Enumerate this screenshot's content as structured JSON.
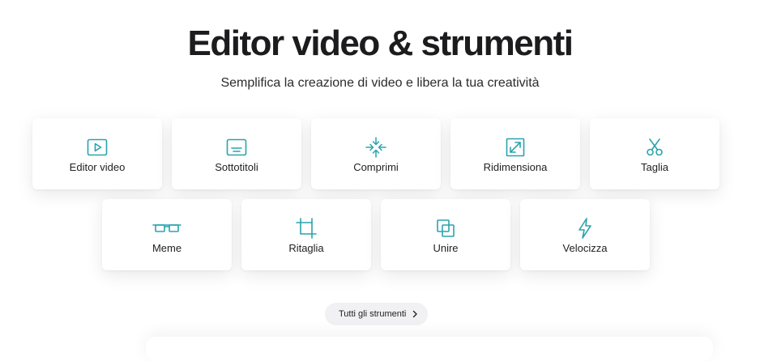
{
  "header": {
    "title": "Editor video & strumenti",
    "subtitle": "Semplifica la creazione di video e libera la tua creatività"
  },
  "colors": {
    "accent": "#2aa3ad",
    "card_background": "#ffffff",
    "button_background": "#f1f1f3"
  },
  "tools": {
    "row1": [
      {
        "label": "Editor video",
        "icon": "play-icon"
      },
      {
        "label": "Sottotitoli",
        "icon": "subtitles-icon"
      },
      {
        "label": "Comprimi",
        "icon": "compress-icon"
      },
      {
        "label": "Ridimensiona",
        "icon": "resize-icon"
      },
      {
        "label": "Taglia",
        "icon": "scissors-icon"
      }
    ],
    "row2": [
      {
        "label": "Meme",
        "icon": "glasses-icon"
      },
      {
        "label": "Ritaglia",
        "icon": "crop-icon"
      },
      {
        "label": "Unire",
        "icon": "merge-icon"
      },
      {
        "label": "Velocizza",
        "icon": "lightning-icon"
      }
    ]
  },
  "more_button": {
    "label": "Tutti gli strumenti",
    "icon": "chevron-right-icon"
  }
}
